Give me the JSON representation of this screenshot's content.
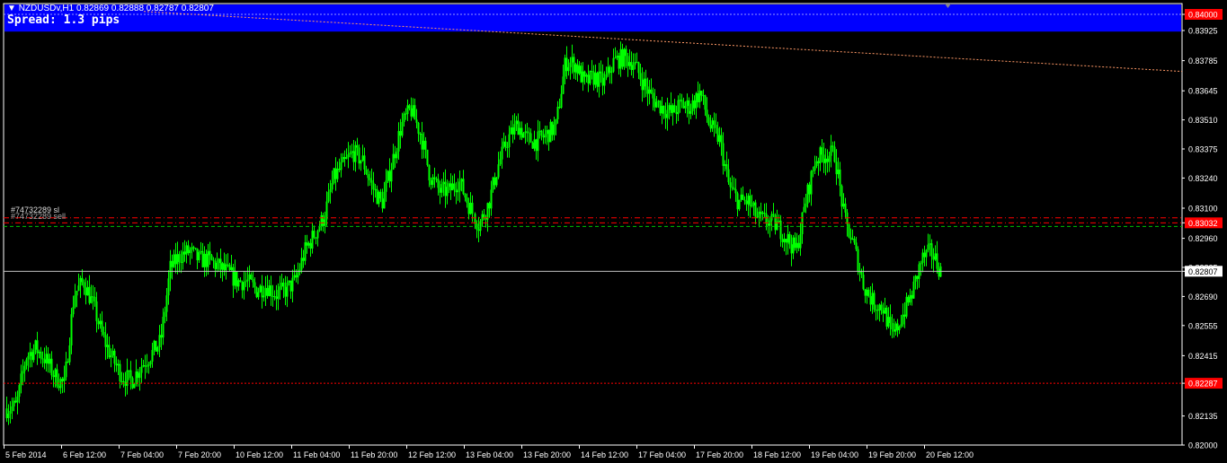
{
  "header": {
    "symbol_line": "NZDUSDv,H1  0.82869 0.82888 0.82787 0.82807",
    "spread": "Spread: 1.3 pips"
  },
  "orders": {
    "sl_label": "#74732289 sl",
    "sell_label": "#74732289 sell"
  },
  "colors": {
    "background": "#000000",
    "candle": "#00ff00",
    "spread_band": "#0000ff",
    "stop_line": "#ff0000",
    "entry_line": "#00c000",
    "price_tag_red": "#ff0000",
    "price_tag_white": "#ffffff",
    "ma_line": "#ff9966"
  },
  "chart_data": {
    "type": "candlestick",
    "symbol": "NZDUSDv",
    "timeframe": "H1",
    "last": {
      "open": 0.82869,
      "high": 0.82888,
      "low": 0.82787,
      "close": 0.82807
    },
    "ylim": [
      0.82,
      0.8405
    ],
    "y_ticks": [
      "0.84000",
      "0.83925",
      "0.83785",
      "0.83645",
      "0.83510",
      "0.83375",
      "0.83240",
      "0.83100",
      "0.83032",
      "0.82960",
      "0.82825",
      "0.82807",
      "0.82690",
      "0.82555",
      "0.82415",
      "0.82287",
      "0.82135",
      "0.82000"
    ],
    "x_ticks": [
      "5 Feb 2014",
      "6 Feb 12:00",
      "7 Feb 04:00",
      "7 Feb 20:00",
      "10 Feb 12:00",
      "11 Feb 04:00",
      "11 Feb 20:00",
      "12 Feb 12:00",
      "13 Feb 04:00",
      "13 Feb 20:00",
      "14 Feb 12:00",
      "17 Feb 04:00",
      "17 Feb 20:00",
      "18 Feb 12:00",
      "19 Feb 04:00",
      "19 Feb 20:00",
      "20 Feb 12:00"
    ],
    "levels": {
      "spread_band_top": 0.84,
      "spread_band_bottom": 0.8392,
      "top_dotted": 0.84,
      "stop_loss": 0.83055,
      "sell_entry": 0.83032,
      "sell_entry_green": 0.83015,
      "current_price": 0.82807,
      "take_profit": 0.82287
    },
    "price_tags": [
      {
        "label": "0.84000",
        "value": 0.84,
        "style": "red"
      },
      {
        "label": "0.83032",
        "value": 0.83032,
        "style": "red"
      },
      {
        "label": "0.82807",
        "value": 0.82807,
        "style": "white"
      },
      {
        "label": "0.82287",
        "value": 0.82287,
        "style": "red"
      }
    ],
    "ma_line": {
      "start": 0.8393,
      "end": 0.83735
    },
    "anchor_path": [
      0.8217,
      0.8218,
      0.8241,
      0.8245,
      0.824,
      0.8232,
      0.8228,
      0.827,
      0.8276,
      0.8265,
      0.825,
      0.824,
      0.8232,
      0.823,
      0.8237,
      0.8242,
      0.8248,
      0.8282,
      0.8288,
      0.829,
      0.8286,
      0.8286,
      0.8283,
      0.828,
      0.8276,
      0.8276,
      0.8272,
      0.8274,
      0.827,
      0.8272,
      0.8276,
      0.829,
      0.8298,
      0.8306,
      0.8324,
      0.833,
      0.8336,
      0.8332,
      0.832,
      0.8312,
      0.833,
      0.8348,
      0.8356,
      0.8345,
      0.8325,
      0.8318,
      0.8318,
      0.8323,
      0.8312,
      0.8302,
      0.8312,
      0.833,
      0.8342,
      0.8349,
      0.8342,
      0.8341,
      0.8344,
      0.8348,
      0.8378,
      0.8377,
      0.8368,
      0.8371,
      0.8368,
      0.8378,
      0.838,
      0.8378,
      0.8369,
      0.8361,
      0.8357,
      0.8354,
      0.8358,
      0.8357,
      0.8364,
      0.8348,
      0.8342,
      0.832,
      0.8313,
      0.8313,
      0.8305,
      0.8304,
      0.8302,
      0.8296,
      0.829,
      0.8314,
      0.8333,
      0.8335,
      0.8335,
      0.8305,
      0.8292,
      0.8274,
      0.8266,
      0.8264,
      0.825,
      0.826,
      0.827,
      0.8286,
      0.829,
      0.8281
    ]
  }
}
